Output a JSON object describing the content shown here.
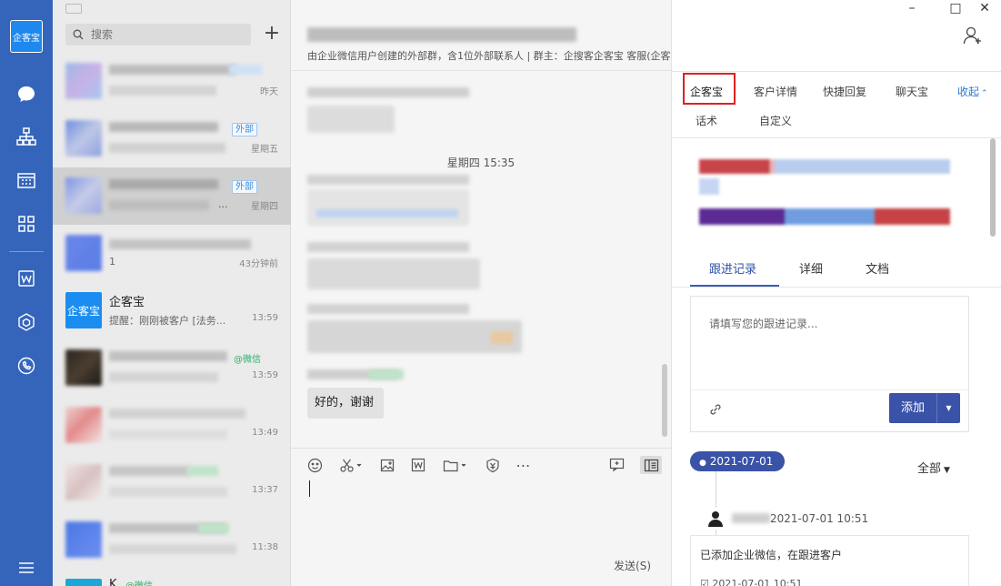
{
  "rail": {
    "logo_text": "企客宝",
    "icons": [
      "chat-icon",
      "org-chart-icon",
      "calendar-icon",
      "apps-grid-icon",
      "doc-w-icon",
      "cube-icon",
      "phone-cloud-icon",
      "menu-icon"
    ]
  },
  "list": {
    "search_placeholder": "搜索",
    "add_label": "+",
    "items": [
      {
        "title": "",
        "subtitle": "",
        "time": "昨天",
        "tag": ""
      },
      {
        "title": "",
        "subtitle": "",
        "time": "星期五",
        "tag": "外部"
      },
      {
        "title": "",
        "subtitle": "...",
        "time": "星期四",
        "tag": "外部"
      },
      {
        "title": "",
        "subtitle": "1",
        "time": "43分钟前",
        "tag": ""
      },
      {
        "title": "企客宝",
        "subtitle": "提醒：刚刚被客户 [法务...",
        "time": "13:59",
        "tag": ""
      },
      {
        "title": "",
        "subtitle": "",
        "time": "13:59",
        "tag": "@微信"
      },
      {
        "title": "",
        "subtitle": "",
        "time": "13:49",
        "tag": ""
      },
      {
        "title": "",
        "subtitle": "",
        "time": "13:37",
        "tag": ""
      },
      {
        "title": "",
        "subtitle": "",
        "time": "11:38",
        "tag": ""
      },
      {
        "title": "K",
        "subtitle": "",
        "time": "",
        "tag": "@微信"
      }
    ]
  },
  "chat": {
    "group_subtitle": "由企业微信用户创建的外部群，含1位外部联系人 | 群主：企搜客企客宝 客服(企客宝企搜客客服)",
    "time_divider": "星期四 15:35",
    "last_message": "好的，谢谢",
    "send_label": "发送(S)"
  },
  "panel": {
    "tabs_row1": [
      "企客宝",
      "客户详情",
      "快捷回复",
      "聊天宝"
    ],
    "collapse_label": "收起",
    "tabs_row2": [
      "话术",
      "自定义"
    ],
    "record_tabs": [
      "跟进记录",
      "详细",
      "文档"
    ],
    "note_placeholder": "请填写您的跟进记录...",
    "add_label": "添加",
    "date_badge": "2021-07-01",
    "filter_label": "全部",
    "entry_time": "2021-07-01 10:51",
    "entry_text": "已添加企业微信，在跟进客户",
    "entry_time2": "2021-07-01 10:51"
  },
  "colors": {
    "rail": "#3565bb",
    "accent": "#3a52a8",
    "highlight": "#e02020"
  }
}
